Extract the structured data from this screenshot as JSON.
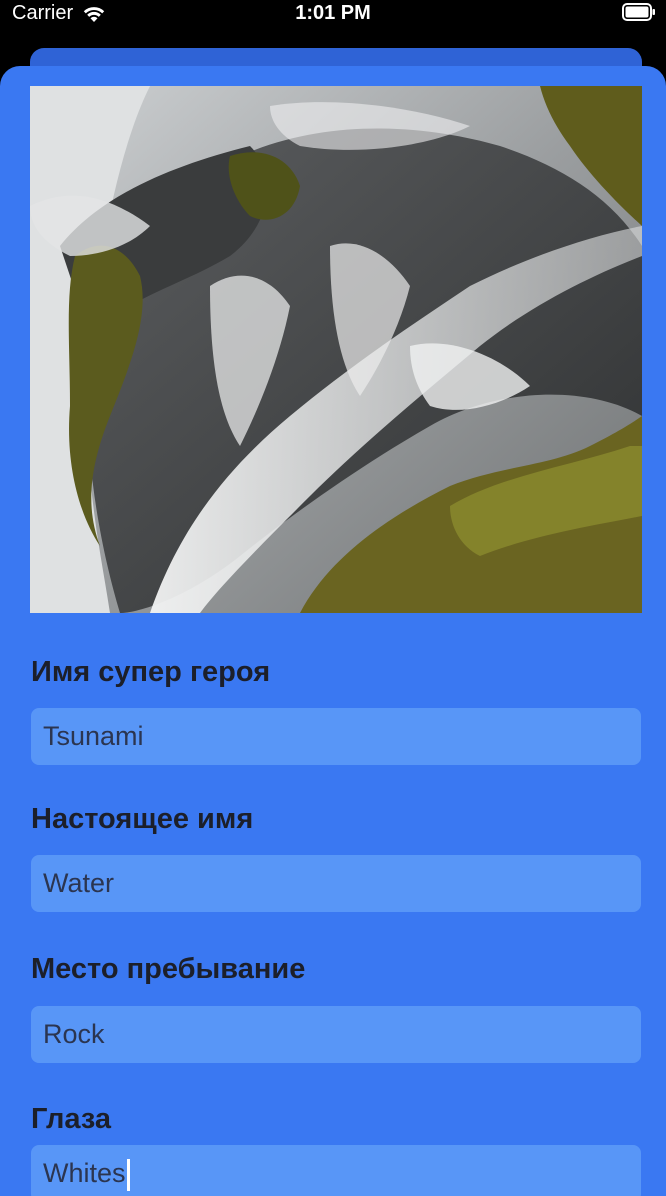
{
  "status_bar": {
    "carrier": "Carrier",
    "time": "1:01 PM"
  },
  "image": {
    "description_icon": "waterfall-photo"
  },
  "form": {
    "superhero_name": {
      "label": "Имя супер героя",
      "value": "Tsunami"
    },
    "real_name": {
      "label": "Настоящее имя",
      "value": "Water"
    },
    "residence": {
      "label": "Место пребывание",
      "value": "Rock"
    },
    "eyes": {
      "label": "Глаза",
      "value": "Whites"
    }
  },
  "colors": {
    "sheet": "#3a78f2",
    "field": "#5896f7",
    "sheet_back": "#2f63d6"
  }
}
